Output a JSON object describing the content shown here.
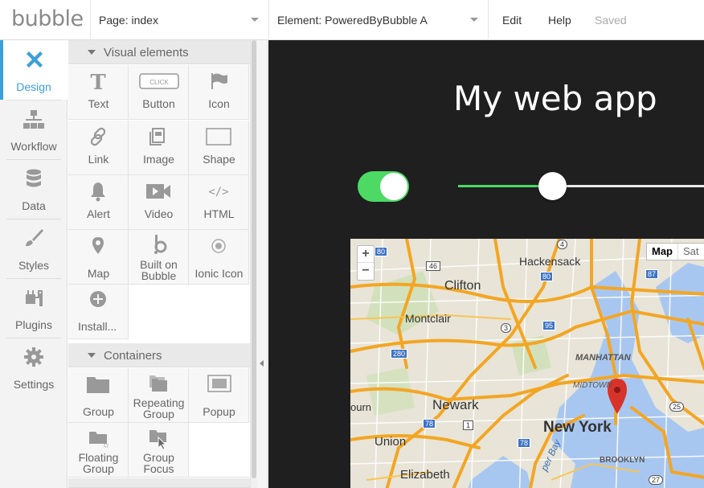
{
  "app": {
    "logo": "bubble"
  },
  "topbar": {
    "page_select": "Page: index",
    "element_select": "Element: PoweredByBubble A",
    "menu_edit": "Edit",
    "menu_help": "Help",
    "status": "Saved"
  },
  "leftnav": {
    "items": [
      {
        "label": "Design",
        "icon": "design-icon",
        "active": true
      },
      {
        "label": "Workflow",
        "icon": "workflow-icon"
      },
      {
        "label": "Data",
        "icon": "database-icon"
      },
      {
        "label": "Styles",
        "icon": "brush-icon"
      },
      {
        "label": "Plugins",
        "icon": "plug-icon"
      },
      {
        "label": "Settings",
        "icon": "gear-icon"
      }
    ]
  },
  "panel": {
    "visual_title": "Visual elements",
    "visual": [
      {
        "label": "Text",
        "icon": "text-icon"
      },
      {
        "label": "Button",
        "icon": "button-icon",
        "icon_text": "CLICK"
      },
      {
        "label": "Icon",
        "icon": "flag-icon"
      },
      {
        "label": "Link",
        "icon": "link-icon"
      },
      {
        "label": "Image",
        "icon": "image-icon"
      },
      {
        "label": "Shape",
        "icon": "shape-icon"
      },
      {
        "label": "Alert",
        "icon": "bell-icon"
      },
      {
        "label": "Video",
        "icon": "video-icon"
      },
      {
        "label": "HTML",
        "icon": "code-icon",
        "icon_text": "</>"
      },
      {
        "label": "Map",
        "icon": "map-pin-icon"
      },
      {
        "label": "Built on Bubble",
        "icon": "bubble-icon"
      },
      {
        "label": "Ionic Icon",
        "icon": "ionic-icon"
      },
      {
        "label": "Install...",
        "icon": "plus-circle-icon"
      }
    ],
    "containers_title": "Containers",
    "containers": [
      {
        "label": "Group",
        "icon": "folder-icon"
      },
      {
        "label": "Repeating Group",
        "icon": "folders-icon"
      },
      {
        "label": "Popup",
        "icon": "popup-icon"
      },
      {
        "label": "Floating Group",
        "icon": "floating-folder-icon"
      },
      {
        "label": "Group Focus",
        "icon": "cursor-folder-icon"
      }
    ]
  },
  "canvas": {
    "title": "My web app",
    "toggle_on": true,
    "slider_value": 0.35,
    "map": {
      "zoom_in": "+",
      "zoom_out": "−",
      "type_map": "Map",
      "type_sat": "Sat",
      "labels": {
        "hackensack": "Hackensack",
        "clifton": "Clifton",
        "montclair": "Montclair",
        "manhattan": "MANHATTAN",
        "midtown": "MIDTOWN",
        "newark": "Newark",
        "newyork": "New York",
        "union": "Union",
        "elizabeth": "Elizabeth",
        "brooklyn": "BROOKLYN",
        "burn": "ourn",
        "bay": "per Bay"
      },
      "shields": {
        "s80a": "80",
        "s4": "4",
        "s46": "46",
        "s80b": "80",
        "s87": "87",
        "s3": "3",
        "s95": "95",
        "s280": "280",
        "s1": "1",
        "s78a": "78",
        "s78b": "78",
        "s25": "25",
        "s27": "27"
      }
    }
  }
}
